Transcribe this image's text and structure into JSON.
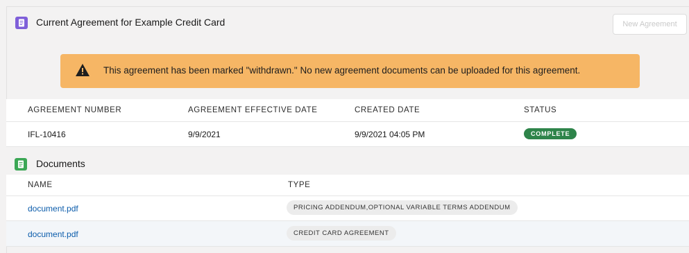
{
  "agreement": {
    "title": "Current Agreement for Example Credit Card",
    "new_button_label": "New Agreement",
    "warning_text": "This agreement has been marked \"withdrawn.\" No new agreement documents can be uploaded for this agreement.",
    "columns": [
      "AGREEMENT NUMBER",
      "AGREEMENT EFFECTIVE DATE",
      "CREATED DATE",
      "STATUS"
    ],
    "row": {
      "number": "IFL-10416",
      "effective_date": "9/9/2021",
      "created_date": "9/9/2021 04:05 PM",
      "status": "COMPLETE"
    }
  },
  "documents": {
    "title": "Documents",
    "columns": [
      "NAME",
      "TYPE"
    ],
    "rows": [
      {
        "name": "document.pdf",
        "type": "PRICING ADDENDUM,OPTIONAL VARIABLE TERMS ADDENDUM"
      },
      {
        "name": "document.pdf",
        "type": "CREDIT CARD AGREEMENT"
      }
    ]
  },
  "colors": {
    "header_icon": "#7f5fd9",
    "documents_icon": "#3ba755",
    "warning_bg": "#f6b665",
    "status_complete": "#2e844a",
    "link": "#0b5cab"
  },
  "icons": {
    "header": "document-icon",
    "warning": "warning-triangle-icon",
    "documents": "document-icon"
  }
}
